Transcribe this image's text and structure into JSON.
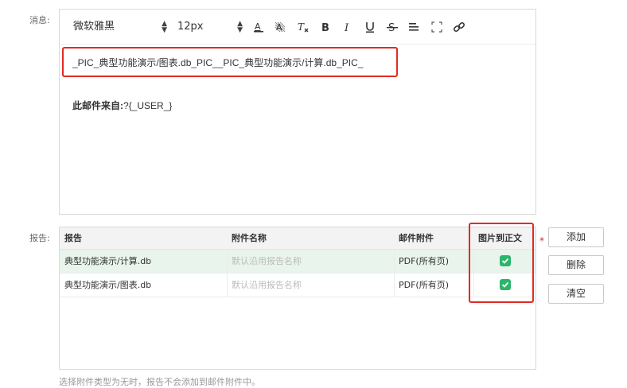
{
  "labels": {
    "message": "消息:",
    "report": "报告:"
  },
  "toolbar": {
    "font_family": "微软雅黑",
    "font_size": "12px",
    "icons": [
      "font-color-icon",
      "background-color-icon",
      "clear-format-icon",
      "bold-icon",
      "italic-icon",
      "underline-icon",
      "strikethrough-icon",
      "align-icon",
      "fullscreen-icon",
      "link-icon"
    ]
  },
  "editor": {
    "pic_line": "_PIC_典型功能演示/图表.db_PIC__PIC_典型功能演示/计算.db_PIC_",
    "from_label": "此邮件来自:",
    "from_value": "?{_USER_}"
  },
  "report_table": {
    "headers": [
      "报告",
      "附件名称",
      "邮件附件",
      "图片到正文"
    ],
    "rows": [
      {
        "report": "典型功能演示/计算.db",
        "attachment_name_placeholder": "默认沿用报告名称",
        "mail_attachment": "PDF(所有页)",
        "pic_to_body": true,
        "selected": true
      },
      {
        "report": "典型功能演示/图表.db",
        "attachment_name_placeholder": "默认沿用报告名称",
        "mail_attachment": "PDF(所有页)",
        "pic_to_body": true,
        "selected": false
      }
    ]
  },
  "required_mark": "*",
  "buttons": {
    "add": "添加",
    "delete": "删除",
    "clear": "清空"
  },
  "hint": "选择附件类型为无时，报告不会添加到邮件附件中。",
  "colors": {
    "highlight": "#e12b23",
    "checkbox": "#2db46b",
    "selected_row": "#e9f4ec"
  }
}
